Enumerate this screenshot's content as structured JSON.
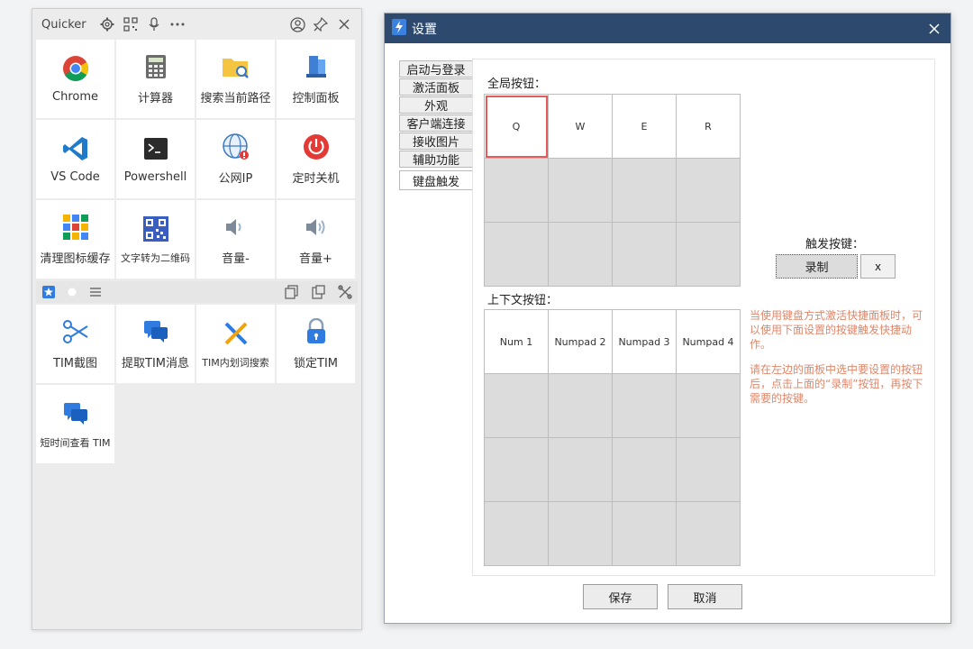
{
  "quicker": {
    "title": "Quicker",
    "top_tiles": [
      {
        "label": "Chrome",
        "icon": "chrome-icon"
      },
      {
        "label": "计算器",
        "icon": "calculator-icon"
      },
      {
        "label": "搜索当前路径",
        "icon": "folder-search-icon"
      },
      {
        "label": "控制面板",
        "icon": "control-panel-icon"
      },
      {
        "label": "VS Code",
        "icon": "vscode-icon"
      },
      {
        "label": "Powershell",
        "icon": "powershell-icon"
      },
      {
        "label": "公网IP",
        "icon": "globe-icon"
      },
      {
        "label": "定时关机",
        "icon": "power-icon"
      },
      {
        "label": "清理图标缓存",
        "icon": "grid-cache-icon"
      },
      {
        "label": "文字转为二维码",
        "icon": "qrcode-icon"
      },
      {
        "label": "音量-",
        "icon": "volume-down-icon"
      },
      {
        "label": "音量+",
        "icon": "volume-up-icon"
      }
    ],
    "bottom_tiles": [
      {
        "label": "TIM截图",
        "icon": "scissors-icon"
      },
      {
        "label": "提取TIM消息",
        "icon": "chat-icon"
      },
      {
        "label": "TIM内划词搜索",
        "icon": "pencil-icon"
      },
      {
        "label": "锁定TIM",
        "icon": "lock-icon"
      },
      {
        "label": "短时间查看 TIM",
        "icon": "chat-icon"
      }
    ]
  },
  "settings": {
    "title": "设置",
    "tabs": [
      "启动与登录",
      "激活面板",
      "外观",
      "客户端连接",
      "接收图片",
      "辅助功能",
      "键盘触发"
    ],
    "active_tab": "键盘触发",
    "global_label": "全局按钮：",
    "global_keys": [
      "Q",
      "W",
      "E",
      "R",
      "",
      "",
      "",
      "",
      "",
      "",
      "",
      ""
    ],
    "context_label": "上下文按钮：",
    "context_keys": [
      "Num 1",
      "Numpad 2",
      "Numpad 3",
      "Numpad 4",
      "",
      "",
      "",
      "",
      "",
      "",
      "",
      "",
      "",
      "",
      "",
      ""
    ],
    "trigger_label": "触发按键：",
    "record_label": "录制",
    "clear_label": "x",
    "hint1": "当使用键盘方式激活快捷面板时，可以使用下面设置的按键触发快捷动作。",
    "hint2": "请在左边的面板中选中要设置的按钮后，点击上面的“录制”按钮，再按下需要的按键。",
    "save_label": "保存",
    "cancel_label": "取消"
  }
}
